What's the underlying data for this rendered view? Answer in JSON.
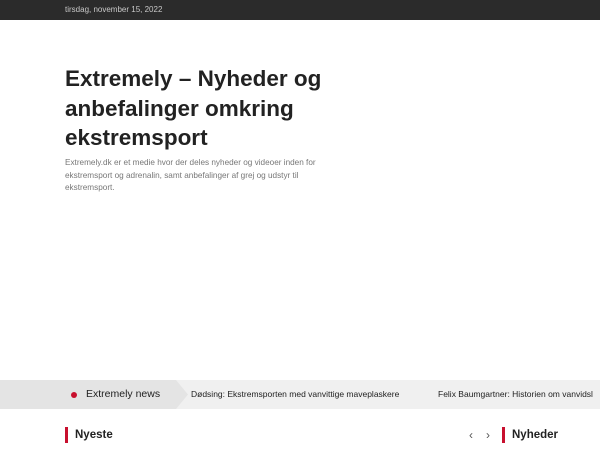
{
  "topbar": {
    "date": "tirsdag, november 15, 2022"
  },
  "hero": {
    "title": "Extremely – Nyheder og anbefalinger omkring ekstremsport",
    "description": "Extremely.dk er et medie hvor der deles nyheder og videoer inden for ekstremsport og adrenalin, samt anbefalinger af grej og udstyr til ekstremsport."
  },
  "ticker": {
    "label": "Extremely news",
    "items": [
      "Dødsing: Ekstremsporten med vanvittige maveplaskere",
      "Felix Baumgartner: Historien om vanvidsl"
    ]
  },
  "sections": {
    "left_title": "Nyeste",
    "right_title": "Nyheder",
    "prev_arrow": "‹",
    "next_arrow": "›"
  },
  "colors": {
    "accent": "#c8102e",
    "topbar_bg": "#2b2b2b",
    "ticker_bg": "#f0f0f0"
  }
}
